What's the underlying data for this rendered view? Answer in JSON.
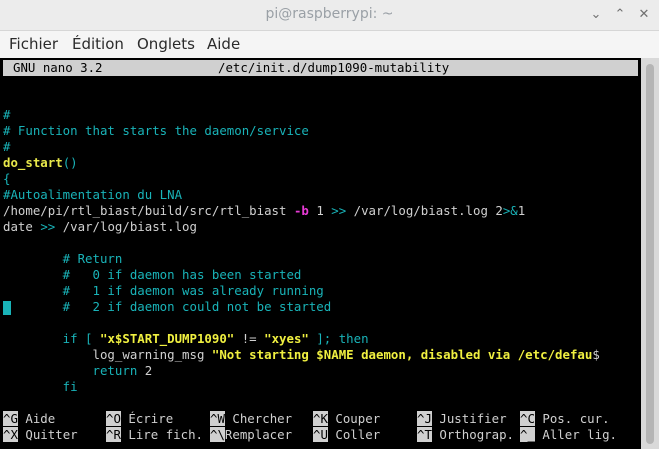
{
  "window": {
    "title": "pi@raspberrypi: ~",
    "buttons": [
      "minimize-icon",
      "maximize-icon",
      "close-icon"
    ]
  },
  "menubar": {
    "items": [
      "Fichier",
      "Édition",
      "Onglets",
      "Aide"
    ]
  },
  "nano": {
    "version": "GNU nano 3.2",
    "filename": "/etc/init.d/dump1090-mutability"
  },
  "file": {
    "l1": "#",
    "l2": "# Function that starts the daemon/service",
    "l3": "#",
    "l4_func": "do_start",
    "l4_paren": "()",
    "l5": "{",
    "l6": "#Autoalimentation du LNA",
    "l7_cmd": "/home/pi/rtl_biast/build/src/rtl_biast ",
    "l7_opt": "-b",
    "l7_arg": " 1 ",
    "l7_redir": ">>",
    "l7_path": " /var/log/biast.log 2",
    "l7_redir2": ">&",
    "l7_end": "1",
    "l8_cmd": "date ",
    "l8_redir": ">>",
    "l8_path": " /var/log/biast.log",
    "r1": "        # Return",
    "r2": "        #   0 if daemon has been started",
    "r3": "        #   1 if daemon was already running",
    "r4": "        #   2 if daemon could not be started",
    "if_kw": "        if [ ",
    "if_str1": "\"x$START_DUMP1090\"",
    "if_op": " != ",
    "if_str2": "\"xyes\"",
    "if_end": " ]; then",
    "warn_cmd": "            log_warning_msg ",
    "warn_str": "\"Not starting $NAME daemon, disabled via /etc/defau",
    "warn_overflow": "$",
    "ret_kw": "            return",
    "ret_val": " 2",
    "fi": "        fi"
  },
  "shortcuts": [
    {
      "key": "^G",
      "label": "Aide"
    },
    {
      "key": "^O",
      "label": "Écrire"
    },
    {
      "key": "^W",
      "label": "Chercher"
    },
    {
      "key": "^K",
      "label": "Couper"
    },
    {
      "key": "^J",
      "label": "Justifier"
    },
    {
      "key": "^C",
      "label": "Pos. cur."
    },
    {
      "key": "^X",
      "label": "Quitter"
    },
    {
      "key": "^R",
      "label": "Lire fich."
    },
    {
      "key": "^\\",
      "label": "Remplacer"
    },
    {
      "key": "^U",
      "label": "Coller"
    },
    {
      "key": "^T",
      "label": "Orthograp."
    },
    {
      "key": "^_",
      "label": "Aller lig."
    }
  ],
  "colors": {
    "terminal_bg": "#000000",
    "comment": "#19b3b8",
    "keyword_string": "#f0f040",
    "option": "#e83ad6",
    "text": "#d0d0d0"
  }
}
